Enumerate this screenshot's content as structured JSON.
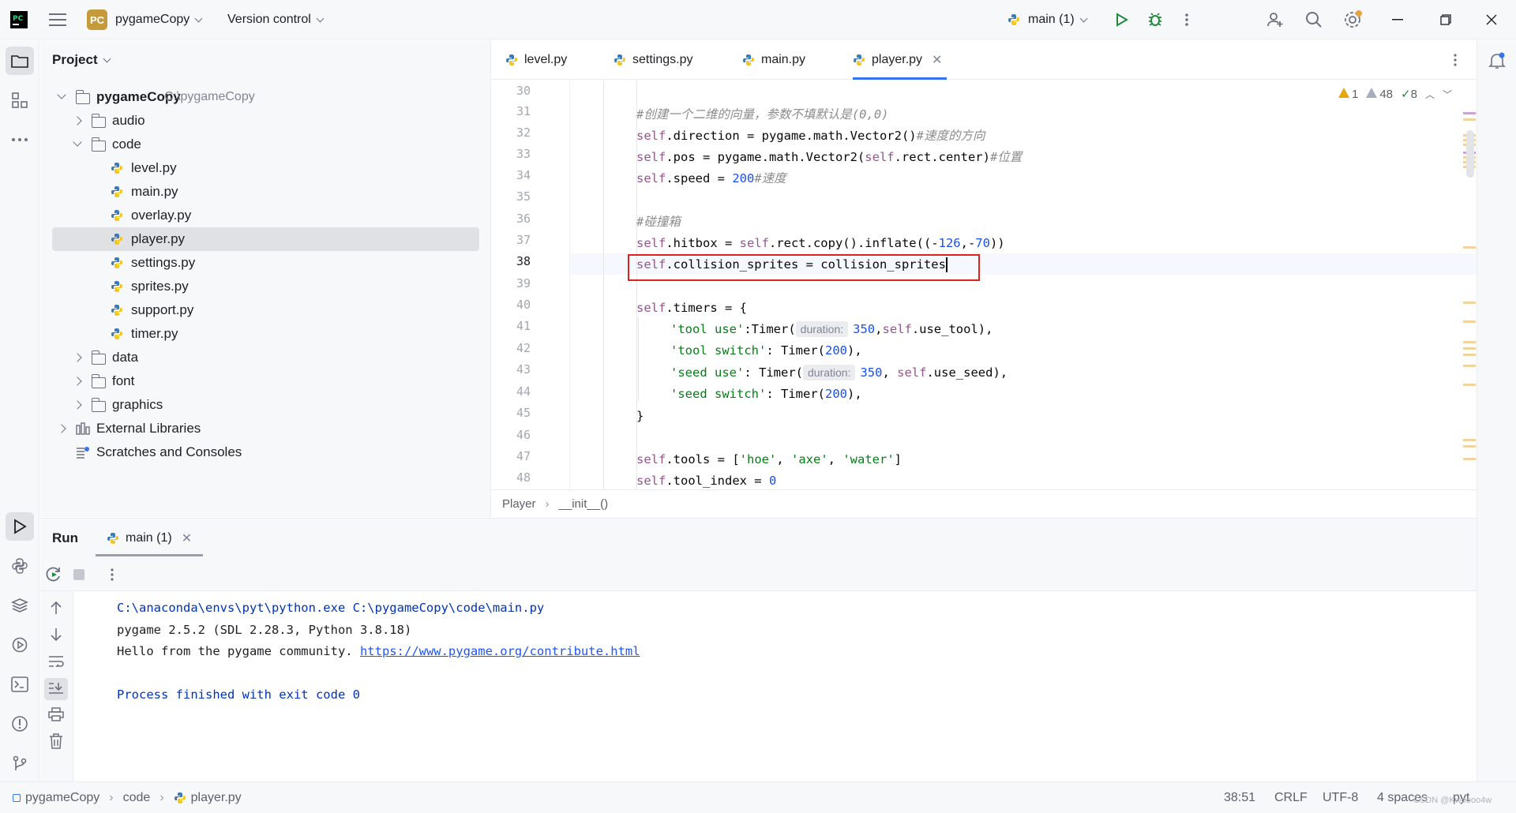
{
  "titlebar": {
    "project_badge": "PC",
    "project_name": "pygameCopy",
    "version_control": "Version control",
    "run_config": "main (1)"
  },
  "project_panel": {
    "title": "Project",
    "root": {
      "name": "pygameCopy",
      "path": "C:\\pygameCopy"
    },
    "items": [
      {
        "label": "audio"
      },
      {
        "label": "code"
      },
      {
        "label": "level.py"
      },
      {
        "label": "main.py"
      },
      {
        "label": "overlay.py"
      },
      {
        "label": "player.py"
      },
      {
        "label": "settings.py"
      },
      {
        "label": "sprites.py"
      },
      {
        "label": "support.py"
      },
      {
        "label": "timer.py"
      },
      {
        "label": "data"
      },
      {
        "label": "font"
      },
      {
        "label": "graphics"
      },
      {
        "label": "External Libraries"
      },
      {
        "label": "Scratches and Consoles"
      }
    ]
  },
  "editor": {
    "tabs": [
      {
        "label": "level.py"
      },
      {
        "label": "settings.py"
      },
      {
        "label": "main.py"
      },
      {
        "label": "player.py"
      }
    ],
    "inspections": {
      "errors": "1",
      "warnings": "48",
      "ok": "8"
    },
    "line_numbers": [
      "30",
      "31",
      "32",
      "33",
      "34",
      "35",
      "36",
      "37",
      "38",
      "39",
      "40",
      "41",
      "42",
      "43",
      "44",
      "45",
      "46",
      "47",
      "48"
    ],
    "code": {
      "l31_comment": "#创建一个二维的向量，参数不填默认是(0,0)",
      "l32_a": ".direction = pygame.math.Vector2()",
      "l32_comment": "#速度的方向",
      "l33_a": ".pos = pygame.math.Vector2(",
      "l33_b": ".rect.center)",
      "l33_comment": "#位置",
      "l34_a": ".speed = ",
      "l34_num": "200",
      "l34_comment": "#速度",
      "l36_comment": "#碰撞箱",
      "l37_a": ".hitbox = ",
      "l37_b": ".rect.copy().inflate((-",
      "l37_n1": "126",
      "l37_c": ",-",
      "l37_n2": "70",
      "l37_d": "))",
      "l38_a": ".collision_sprites = collision_sprites",
      "l40_a": ".timers = {",
      "l41_str": "'tool use'",
      "l41_a": ":Timer(",
      "l41_hint": "duration:",
      "l41_num": "350",
      "l41_b": ",",
      "l41_c": ".use_tool),",
      "l42_str": "'tool switch'",
      "l42_a": ": Timer(",
      "l42_num": "200",
      "l42_b": "),",
      "l43_str": "'seed use'",
      "l43_a": ": Timer(",
      "l43_hint": "duration:",
      "l43_num": "350",
      "l43_b": ", ",
      "l43_c": ".use_seed),",
      "l44_str": "'seed switch'",
      "l44_a": ": Timer(",
      "l44_num": "200",
      "l44_b": "),",
      "l45": "}",
      "l47_a": ".tools = [",
      "l47_s1": "'hoe'",
      "l47_s2": "'axe'",
      "l47_s3": "'water'",
      "l47_sep": ", ",
      "l47_b": "]",
      "l48_a": ".tool_index = ",
      "l48_num": "0",
      "self": "self"
    },
    "breadcrumb": [
      "Player",
      "__init__()"
    ]
  },
  "run": {
    "title": "Run",
    "tab_label": "main (1)",
    "console": {
      "cmd": "C:\\anaconda\\envs\\pyt\\python.exe C:\\pygameCopy\\code\\main.py",
      "line2": "pygame 2.5.2 (SDL 2.28.3, Python 3.8.18)",
      "line3_text": "Hello from the pygame community. ",
      "line3_link": "https://www.pygame.org/contribute.html",
      "finish": "Process finished with exit code 0"
    }
  },
  "statusbar": {
    "breadcrumb": [
      "pygameCopy",
      "code",
      "player.py"
    ],
    "position": "38:51",
    "line_ending": "CRLF",
    "encoding": "UTF-8",
    "indent": "4 spaces",
    "language": "pyt",
    "watermark": "CSDN @Kwoooo4w"
  },
  "colors": {
    "accent": "#3574f0",
    "highlight_box": "#e0221c",
    "self_keyword": "#94558d",
    "number": "#1750eb",
    "string": "#067d17"
  }
}
